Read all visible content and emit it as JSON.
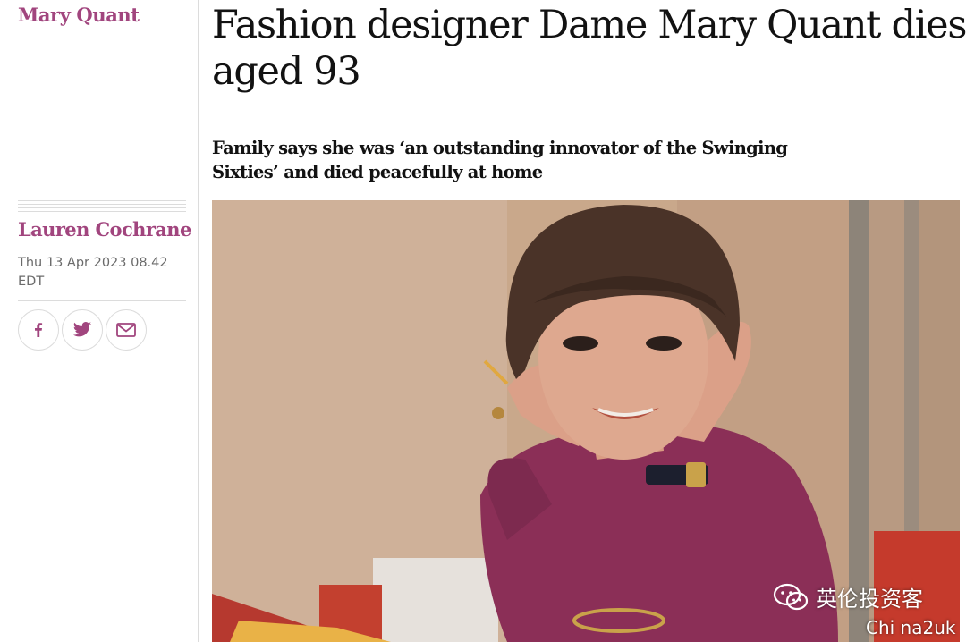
{
  "article": {
    "kicker": "Mary Quant",
    "headline": "Fashion designer Dame Mary Quant dies aged 93",
    "standfirst": "Family says she was ‘an outstanding innovator of the Swinging Sixties’ and died peacefully at home"
  },
  "meta": {
    "byline": "Lauren Cochrane",
    "date": "Thu 13 Apr 2023 08.42 EDT"
  },
  "share": {
    "facebook_icon": "facebook-icon",
    "twitter_icon": "twitter-icon",
    "email_icon": "envelope-icon"
  },
  "photo": {
    "subject": "portrait-photo"
  },
  "watermark": {
    "text": "英伦投资客",
    "sub": "Chi na2uk",
    "icon": "wechat-icon"
  },
  "colors": {
    "accent": "#a1457e",
    "text": "#121212",
    "muted": "#6b6b6b",
    "rule": "#dcdcdc"
  }
}
